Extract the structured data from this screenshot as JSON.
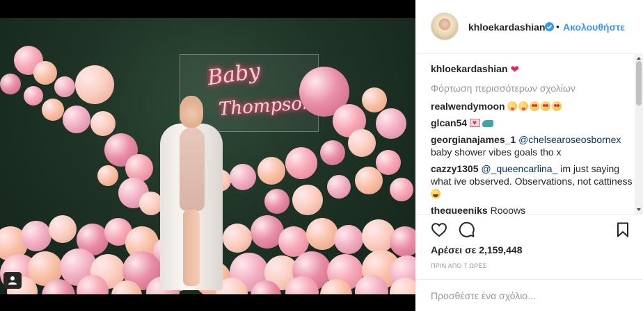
{
  "post": {
    "username": "khloekardashian",
    "follow_label": "Ακολουθήστε",
    "dot": "•",
    "neon_sign": {
      "line1": "Baby",
      "line2": "Thompson"
    }
  },
  "comments": {
    "caption_user": "khloekardashian",
    "load_more": "Φόρτωση περισσότερων σχολίων",
    "items": [
      {
        "user": "realwendymoon"
      },
      {
        "user": "glcan54"
      },
      {
        "user": "georgianajames_1",
        "mention": "@chelsearoseosbornex",
        "text": "baby shower vibes goals tho x"
      },
      {
        "user": "cazzy1305",
        "mention": "@_queencarlina_",
        "text": "im just saying what ive observed. Observations, not cattiness"
      },
      {
        "user": "thequeeniks",
        "text": "Rooows"
      }
    ]
  },
  "engagement": {
    "likes": "Αρέσει σε 2,159,448",
    "time": "ΠΡΙΝ ΑΠΟ 7 ΩΡΕΣ"
  },
  "comment_box": {
    "placeholder": "Προσθέστε ένα σχόλιο..."
  },
  "colors": {
    "link_blue": "#3897f0",
    "mention_blue": "#003569",
    "muted": "#999999",
    "text": "#262626"
  }
}
